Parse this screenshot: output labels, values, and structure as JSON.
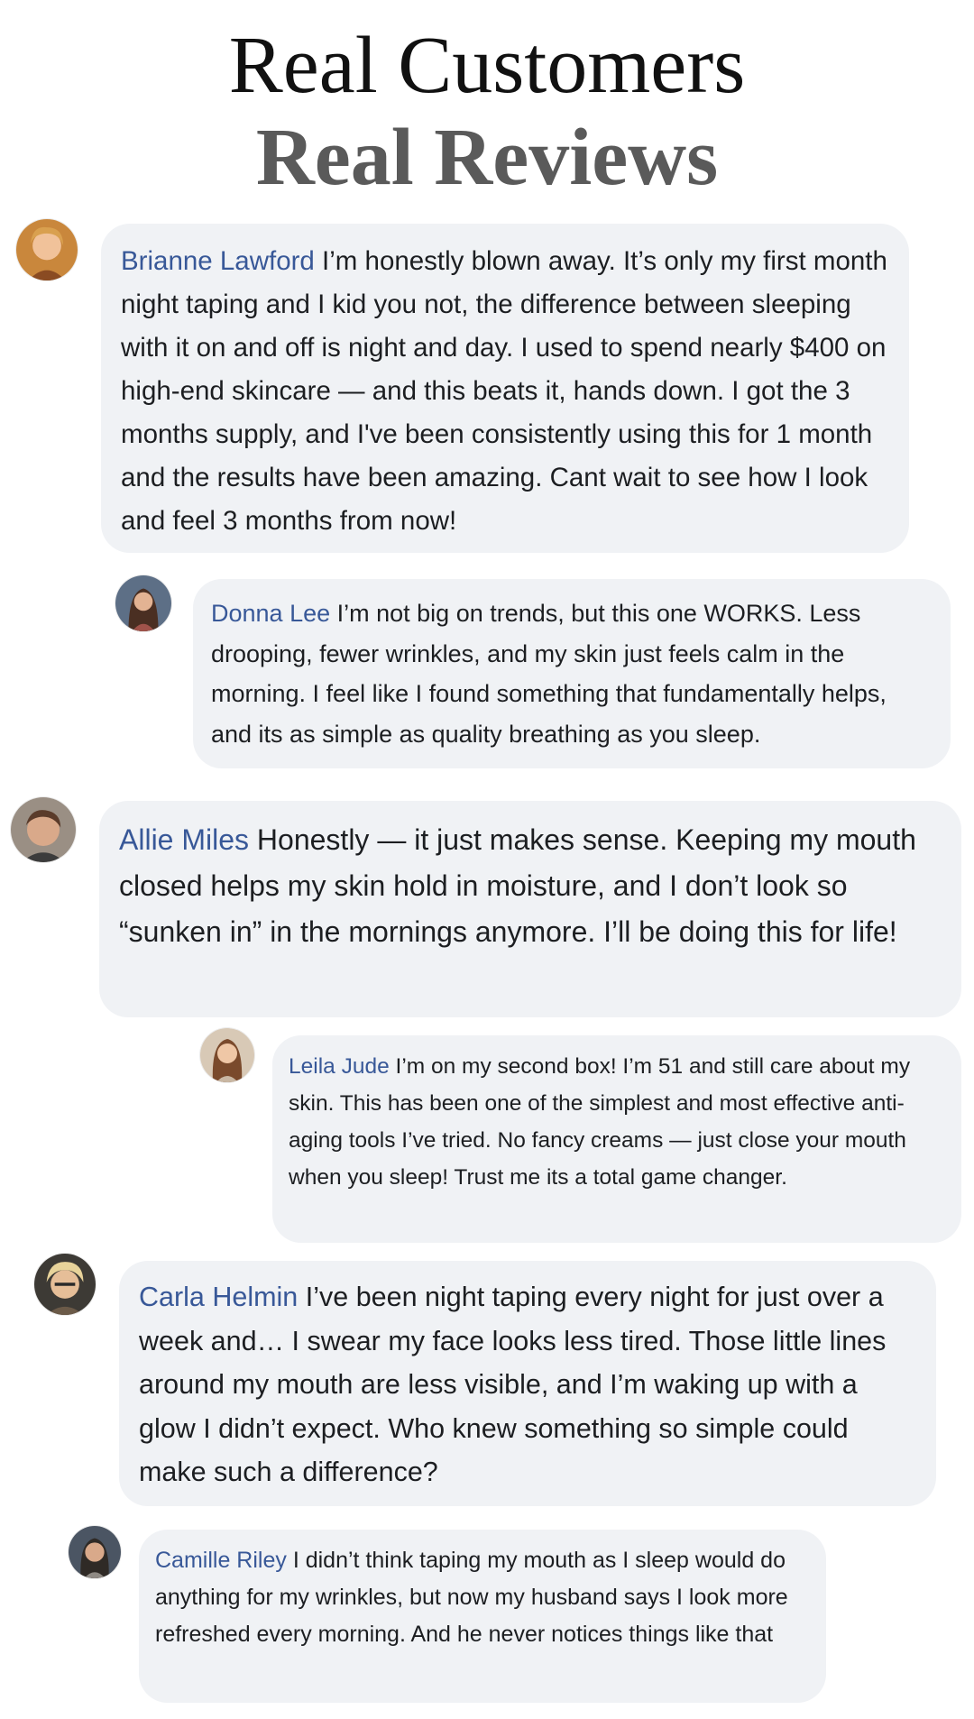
{
  "header": {
    "line1": "Real Customers",
    "line2": "Real Reviews"
  },
  "comments": [
    {
      "name": "Brianne Lawford",
      "text": "I’m honestly blown away. It’s only my first month night taping and I kid you not, the difference between sleeping with it on and off is night and day. I used to spend nearly $400 on high-end skincare — and this beats it, hands down. I got the 3 months supply, and I've been consistently using this for 1 month and the results have been amazing. Cant wait to see how I look and feel 3 months from now!"
    },
    {
      "name": "Donna Lee",
      "text": "I’m not big on trends, but this one WORKS. Less drooping, fewer wrinkles, and my skin just feels calm in the morning. I feel like I found something that fundamentally helps, and its as simple as quality breathing as you sleep."
    },
    {
      "name": "Allie Miles",
      "text": "Honestly — it just makes sense. Keeping my mouth closed helps my skin hold in moisture, and I don’t look so “sunken in” in the mornings anymore. I’ll be doing this for life!"
    },
    {
      "name": "Leila Jude",
      "text": "I’m on my second box! I’m 51 and still care about my skin. This has been one of the simplest and most effective anti-aging tools I’ve tried. No fancy creams — just close your mouth when you sleep! Trust me its a total game changer."
    },
    {
      "name": "Carla Helmin",
      "text": "I’ve been night taping every night for just over a week and… I swear my face looks less tired. Those little lines around my mouth are less visible, and I’m waking up with a glow I didn’t expect. Who knew something so simple could make such a difference?"
    },
    {
      "name": "Camille Riley",
      "text": "I didn’t think taping my mouth as I sleep would do anything for my wrinkles, but now my husband says I look more refreshed every morning. And he never notices things like that"
    }
  ],
  "colors": {
    "bubble_bg": "#f0f2f5",
    "name": "#385898",
    "text": "#1c1e21",
    "headline_1": "#111111",
    "headline_2": "#5a5a5a"
  },
  "icons": [
    "avatar-photo"
  ]
}
